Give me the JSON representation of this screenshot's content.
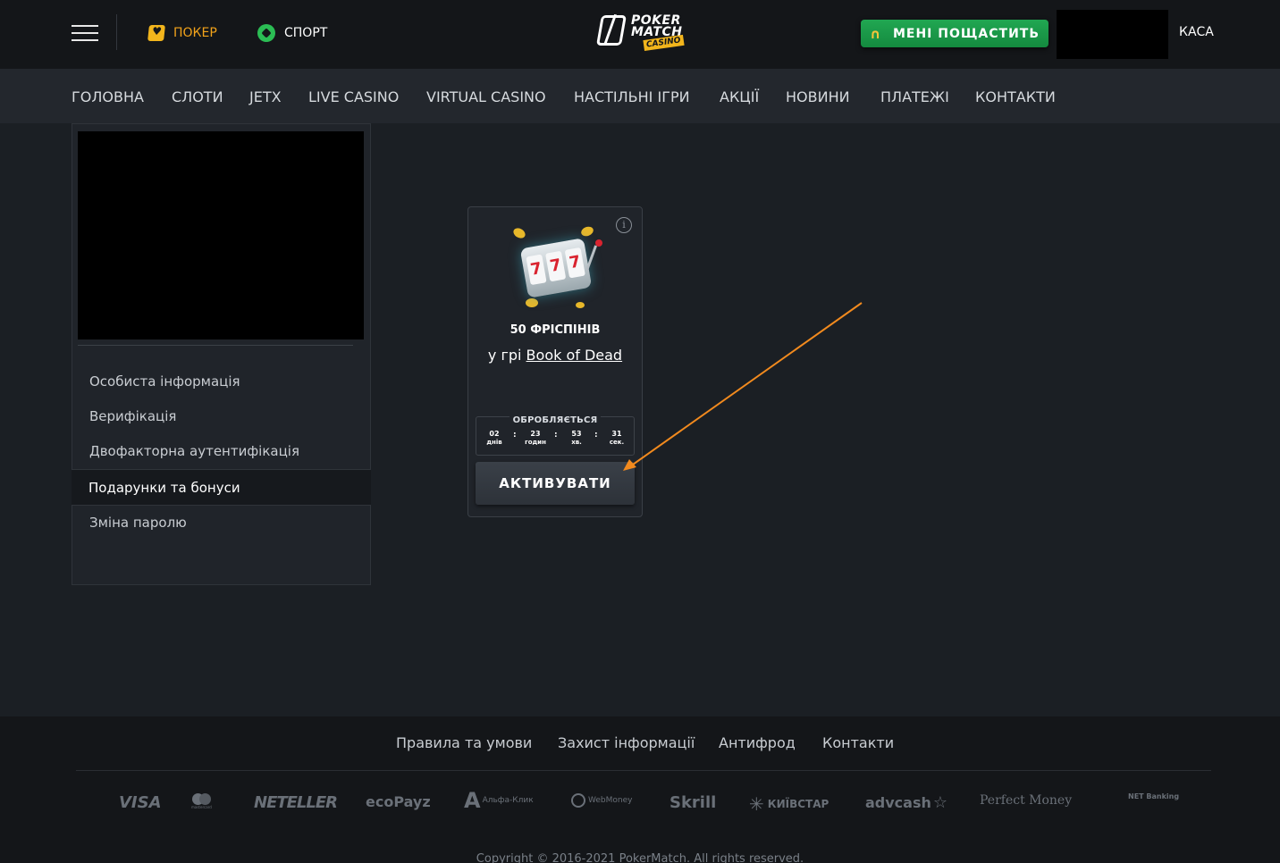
{
  "header": {
    "poker_label": "ПОКЕР",
    "sport_label": "СПОРТ",
    "logo": {
      "line1": "POKER",
      "line2": "MATCH",
      "badge": "CASINO"
    },
    "promo_label": "МЕНІ ПОЩАСТИТЬ",
    "kasa_label": "КАСА",
    "accent_color": "#f2a31a",
    "promo_color": "#1a9a49"
  },
  "nav": {
    "items": [
      "ГОЛОВНА",
      "СЛОТИ",
      "JETX",
      "LIVE CASINO",
      "VIRTUAL CASINO",
      "НАСТІЛЬНІ ІГРИ",
      "АКЦІЇ",
      "НОВИНИ",
      "ПЛАТЕЖІ",
      "КОНТАКТИ"
    ]
  },
  "sidebar": {
    "items": [
      "Особиста інформація",
      "Верифікація",
      "Двофакторна аутентифікація",
      "Подарунки та бонуси",
      "Зміна паролю"
    ],
    "active_index": 3
  },
  "bonus_card": {
    "info_icon": "i",
    "title": "50 ФРІСПІНІВ",
    "subtitle_prefix": "у грі",
    "game_link": "Book of Dead",
    "status_label": "ОБРОБЛЯЄТЬСЯ",
    "timer": [
      {
        "value": "02",
        "unit": "днів"
      },
      {
        "value": "23",
        "unit": "годин"
      },
      {
        "value": "53",
        "unit": "хв."
      },
      {
        "value": "31",
        "unit": "сек."
      }
    ],
    "activate_label": "АКТИВУВАТИ"
  },
  "footer": {
    "links": [
      "Правила та умови",
      "Захист інформації",
      "Антифрод",
      "Контакти"
    ],
    "payments": [
      "VISA",
      "mastercard",
      "NETELLER",
      "ecoPayz",
      "Альфа-Клик",
      "WebMoney",
      "Skrill",
      "КИЇВСТАР",
      "advcash",
      "Perfect Money",
      "NET Banking"
    ],
    "copyright": "Copyright © 2016-2021 PokerMatch. All rights reserved."
  },
  "annotation_color": "#f28a1e"
}
